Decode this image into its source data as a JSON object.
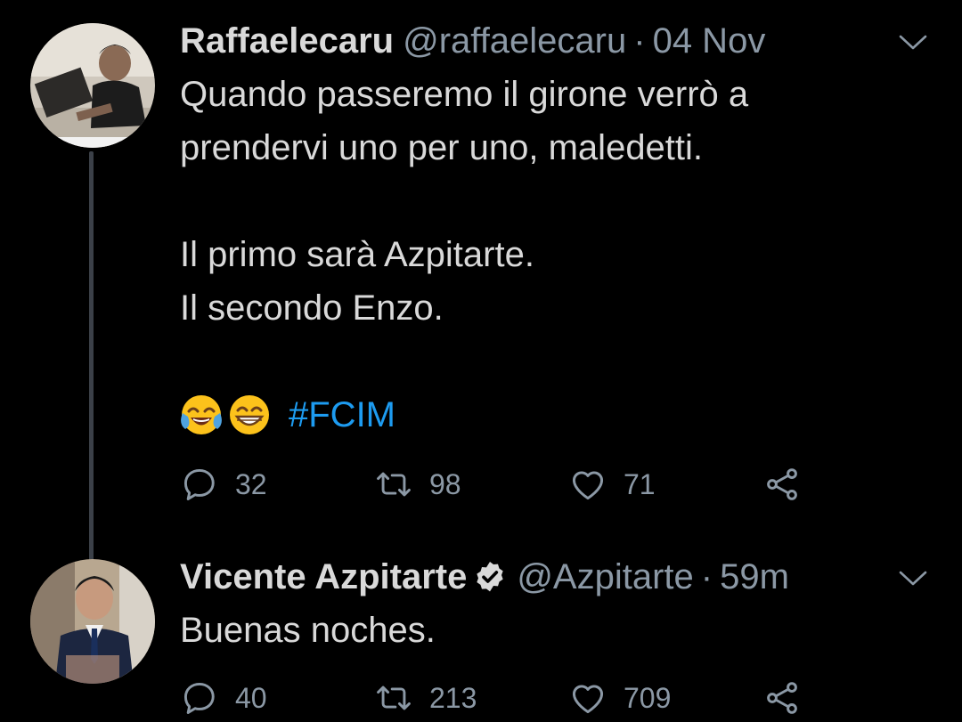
{
  "tweets": [
    {
      "name": "Raffaelecaru",
      "handle": "@raffaelecaru",
      "separator": "·",
      "time": "04 Nov",
      "lines": [
        "Quando passeremo il girone verrò a",
        "prendervi uno per uno, maledetti.",
        "",
        "Il primo sarà Azpitarte.",
        "Il secondo Enzo."
      ],
      "emojis": [
        "face-with-tears-of-joy-emoji",
        "grinning-face-emoji"
      ],
      "hashtag": "#FCIM",
      "replies": "32",
      "retweets": "98",
      "likes": "71"
    },
    {
      "name": "Vicente Azpitarte",
      "verified": true,
      "handle": "@Azpitarte",
      "separator": "·",
      "time": "59m",
      "text": "Buenas noches.",
      "replies": "40",
      "retweets": "213",
      "likes": "709"
    }
  ],
  "colors": {
    "background": "#000000",
    "text": "#d9d9d9",
    "secondary": "#8b98a5",
    "link": "#1d9bf0",
    "thread_line": "#3b4048"
  },
  "icons": [
    "reply-icon",
    "retweet-icon",
    "like-icon",
    "share-icon",
    "chevron-down-icon",
    "verified-badge-icon"
  ]
}
